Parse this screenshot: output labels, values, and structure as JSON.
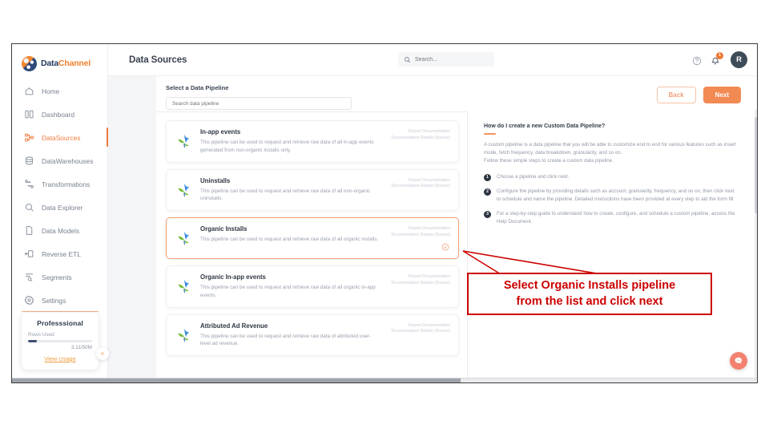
{
  "brand": {
    "part1": "Data",
    "part2": "Channel"
  },
  "sidebar": {
    "items": [
      {
        "label": "Home",
        "icon": "home-icon",
        "active": false
      },
      {
        "label": "Dashboard",
        "icon": "dashboard-icon",
        "active": false
      },
      {
        "label": "DataSources",
        "icon": "datasources-icon",
        "active": true
      },
      {
        "label": "DataWarehouses",
        "icon": "database-icon",
        "active": false
      },
      {
        "label": "Transformations",
        "icon": "transformations-icon",
        "active": false
      },
      {
        "label": "Data Explorer",
        "icon": "explorer-icon",
        "active": false
      },
      {
        "label": "Data Models",
        "icon": "document-icon",
        "active": false
      },
      {
        "label": "Reverse ETL",
        "icon": "reverse-etl-icon",
        "active": false
      },
      {
        "label": "Segments",
        "icon": "segments-icon",
        "active": false
      },
      {
        "label": "Settings",
        "icon": "gear-icon",
        "active": false
      }
    ],
    "plan": {
      "name": "Professsional",
      "rows_label": "Rows Used",
      "usage": "3.11/50M",
      "progress_percent": 14,
      "view_usage": "View Usage"
    },
    "collapse_glyph": "«"
  },
  "header": {
    "title": "Data Sources",
    "search_placeholder": "Search...",
    "search_value": "",
    "help_icon": "help-circle-icon",
    "notification_icon": "bell-icon",
    "notification_count": "1",
    "avatar_initial": "R"
  },
  "panel": {
    "title": "Select a Data Pipeline",
    "search_placeholder": "Search data pipeline",
    "search_value": "",
    "back_label": "Back",
    "next_label": "Next"
  },
  "pipelines": [
    {
      "name": "In-app events",
      "description": "This pipeline can be used to request and retrieve raw data of all in-app events generated from non-organic installs only.",
      "link1": "Report Documentation",
      "link2": "Documentation Details (Source)",
      "selected": false
    },
    {
      "name": "Uninstalls",
      "description": "This pipeline can be used to request and retrieve raw data of all non-organic uninstalls.",
      "link1": "Report Documentation",
      "link2": "Documentation Details (Source)",
      "selected": false
    },
    {
      "name": "Organic Installs",
      "description": "This pipeline can be used to request and retrieve raw data of all organic installs.",
      "link1": "Report Documentation",
      "link2": "Documentation Details (Source)",
      "selected": true
    },
    {
      "name": "Organic In-app events",
      "description": "This pipeline can be used to request and retrieve raw data of all organic in-app events.",
      "link1": "Report Documentation",
      "link2": "Documentation Details (Source)",
      "selected": false
    },
    {
      "name": "Attributed Ad Revenue",
      "description": "This pipeline can be used to request and retrieve raw data of attributed user-level ad revenue.",
      "link1": "Report Documentation",
      "link2": "Documentation Details (Source)",
      "selected": false
    }
  ],
  "help": {
    "title": "How do I create a new Custom Data Pipeline?",
    "paragraph": "A custom pipeline is a data pipeline that you will be able to customize end to end for various features such as insert mode, fetch frequency, data breakdown, granularity, and so on.\nFollow these simple steps to create a custom data pipeline",
    "steps": [
      {
        "num": "1",
        "text": "Choose a pipeline and click next."
      },
      {
        "num": "2",
        "text": "Configure the pipeline by providing details such as account, granularity, frequency, and so on, then click next to schedule and name the pipeline. Detailed instructions have been provided at every step to aid the form fill"
      },
      {
        "num": "3",
        "text": "For a step-by-step guide to understand how to create, configure, and schedule a custom pipeline, access the Help Document."
      }
    ]
  },
  "annotation": {
    "line1": "Select Organic Installs pipeline",
    "line2": "from the list and click next",
    "color": "#cc0000"
  },
  "support": {
    "icon": "chat-bubble-icon"
  },
  "colors": {
    "accent": "#f28a54",
    "brand_blue": "#24375f",
    "brand_orange": "#f08030",
    "selected_border": "#f0a074",
    "annotation_red": "#cc0000"
  }
}
